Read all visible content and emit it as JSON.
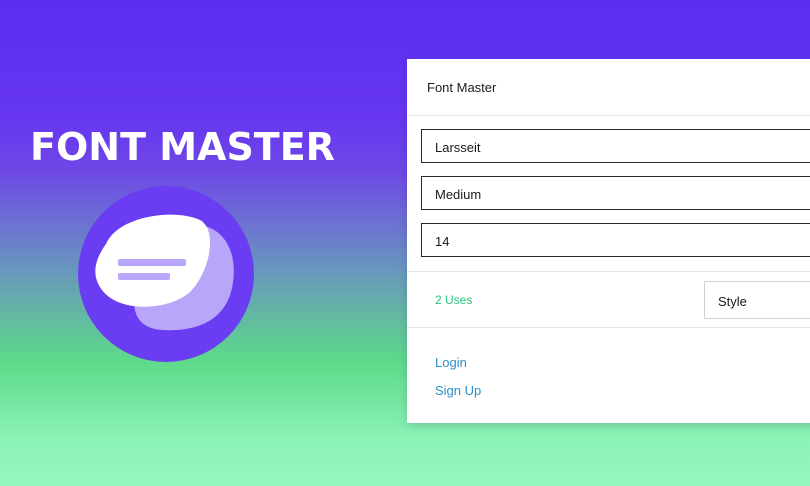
{
  "hero": {
    "title": "FONT MASTER"
  },
  "panel": {
    "title": "Font Master",
    "font_family_value": "Larsseit",
    "font_weight_value": "Medium",
    "font_size_value": "14",
    "uses_label": "2 Uses",
    "style_label": "Style",
    "login_label": "Login",
    "signup_label": "Sign Up"
  },
  "colors": {
    "brand_purple": "#6a3df3",
    "uses_green": "#29c47b",
    "link_blue": "#2e8ec9"
  },
  "icons": [
    "font-master-logo-icon"
  ]
}
